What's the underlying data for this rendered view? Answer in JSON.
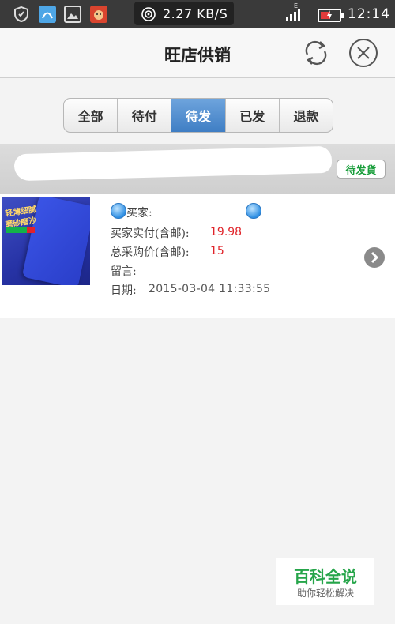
{
  "status_bar": {
    "net_speed": "2.27 KB/S",
    "network_type": "E",
    "time": "12:14"
  },
  "header": {
    "title": "旺店供销"
  },
  "tabs": [
    {
      "label": "全部",
      "active": false
    },
    {
      "label": "待付",
      "active": false
    },
    {
      "label": "待发",
      "active": true
    },
    {
      "label": "已发",
      "active": false
    },
    {
      "label": "退款",
      "active": false
    }
  ],
  "store": {
    "status_badge": "待发貨"
  },
  "order": {
    "product_image_text": [
      "轻薄细腻",
      "磨砂磨沙"
    ],
    "buyer_label": "买家:",
    "actual_paid_label": "买家实付(含邮):",
    "actual_paid_value": "19.98",
    "total_purchase_label": "总采购价(含邮):",
    "total_purchase_value": "15",
    "message_label": "留言:",
    "date_label": "日期:",
    "date_value": "2015-03-04 11:33:55"
  },
  "watermark": {
    "title": "百科全说",
    "subtitle": "助你轻松解决"
  },
  "colors": {
    "accent_blue": "#3f7ec4",
    "price_red": "#e0242a",
    "badge_green": "#1a9e3c"
  }
}
